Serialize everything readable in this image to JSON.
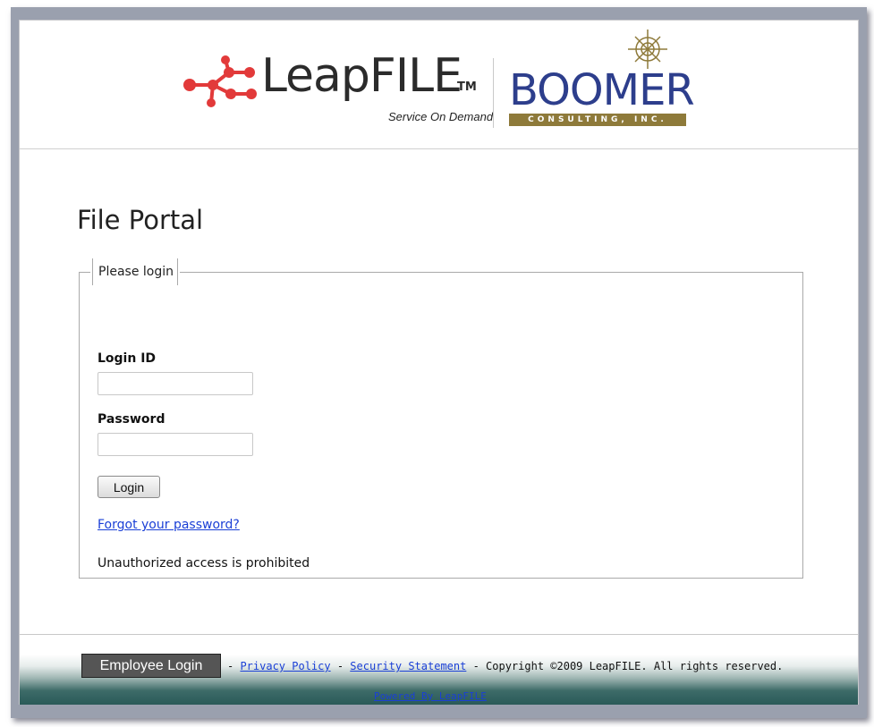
{
  "header": {
    "leapfile_logo": {
      "wordmark": "LeapFILE",
      "tm": "TM",
      "tagline": "Service On Demand"
    },
    "boomer_logo": {
      "wordmark": "BOOMER",
      "subtitle": "CONSULTING, INC."
    }
  },
  "main": {
    "page_title": "File Portal",
    "login_box": {
      "legend": "Please login",
      "login_id_label": "Login ID",
      "login_id_value": "",
      "password_label": "Password",
      "password_value": "",
      "login_button": "Login",
      "forgot_link": "Forgot your password?",
      "notice": "Unauthorized access is prohibited"
    }
  },
  "footer": {
    "employee_login_button": "Employee Login",
    "sep1": " - ",
    "privacy_link": "Privacy Policy",
    "sep2": " - ",
    "security_link": "Security Statement",
    "copyright": " - Copyright ©2009 LeapFILE. All rights reserved.",
    "powered_link": "Powered By LeapFILE"
  },
  "colors": {
    "link": "#1a3fd6",
    "boomer_blue": "#2d3e8c",
    "boomer_gold": "#8e7a3a",
    "leapfile_red": "#e23a3a",
    "footer_teal": "#2a5a58",
    "frame_gray": "#9aa0ae"
  },
  "icons": [
    "leapfile-network-icon",
    "compass-icon"
  ]
}
